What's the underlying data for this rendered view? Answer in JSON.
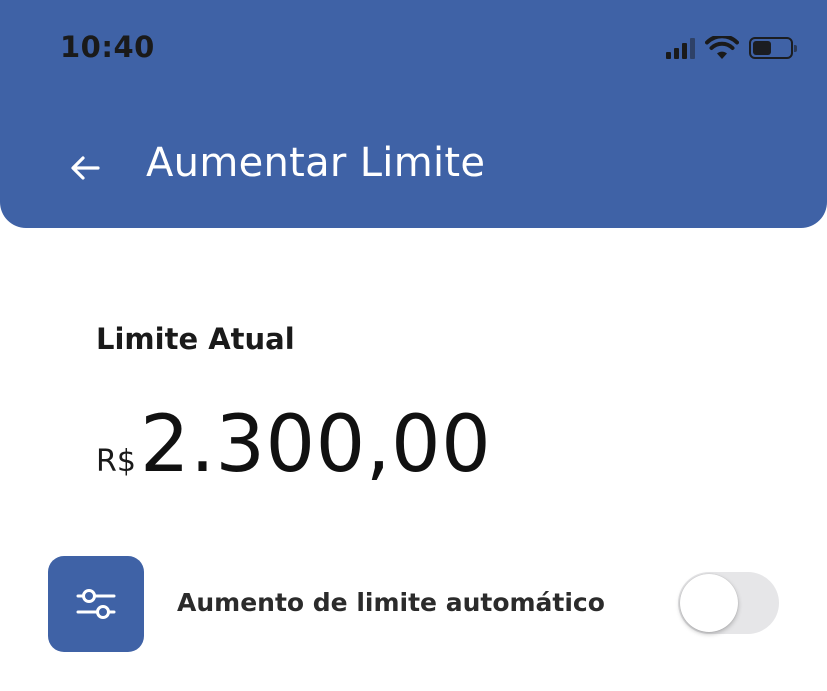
{
  "status_bar": {
    "time": "10:40",
    "signal_icon": "cellular-signal-icon",
    "wifi_icon": "wifi-icon",
    "battery_icon": "battery-icon"
  },
  "header": {
    "back_icon": "arrow-left-icon",
    "title": "Aumentar Limite",
    "background_color": "#3f62a6"
  },
  "limit": {
    "label": "Limite Atual",
    "currency": "R$",
    "value": "2.300,00"
  },
  "auto_increase": {
    "icon": "sliders-icon",
    "label": "Aumento de limite automático",
    "enabled": false
  }
}
